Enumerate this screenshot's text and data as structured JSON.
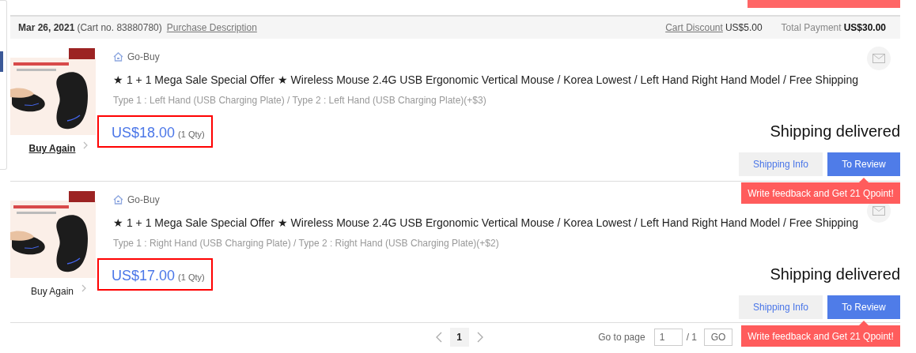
{
  "order_header": {
    "date": "Mar 26, 2021",
    "cart_no": "(Cart no. 83880780)",
    "purchase_description": "Purchase Description",
    "cart_discount_label": "Cart Discount",
    "cart_discount": "US$5.00",
    "total_label": "Total Payment",
    "total": "US$30.00"
  },
  "items": [
    {
      "seller": "Go-Buy",
      "title": "★ 1 + 1 Mega Sale Special Offer ★ Wireless Mouse 2.4G USB Ergonomic Vertical Mouse / Korea Lowest / Left Hand Right Hand Model / Free Shipping",
      "options": "Type 1 : Left Hand (USB Charging Plate) / Type 2 : Left Hand (USB Charging Plate)(+$3)",
      "price": "US$18.00",
      "qty": "(1 Qty)",
      "buy_again": "Buy Again",
      "buy_again_hovered": true,
      "status": "Shipping delivered",
      "shipping_info": "Shipping Info",
      "review": "To Review",
      "tooltip": "Write feedback and Get 21 Qpoint!"
    },
    {
      "seller": "Go-Buy",
      "title": "★ 1 + 1 Mega Sale Special Offer ★ Wireless Mouse 2.4G USB Ergonomic Vertical Mouse / Korea Lowest / Left Hand Right Hand Model / Free Shipping",
      "options": "Type 1 : Right Hand (USB Charging Plate) / Type 2 : Right Hand (USB Charging Plate)(+$2)",
      "price": "US$17.00",
      "qty": "(1 Qty)",
      "buy_again": "Buy Again",
      "buy_again_hovered": false,
      "status": "Shipping delivered",
      "shipping_info": "Shipping Info",
      "review": "To Review",
      "tooltip": "Write feedback and Get 21 Qpoint!"
    }
  ],
  "pagination": {
    "pages": [
      {
        "label": "1",
        "selected": true
      }
    ],
    "go_to_label": "Go to page",
    "page_input": "1",
    "page_total": "/ 1",
    "go_button": "GO"
  }
}
